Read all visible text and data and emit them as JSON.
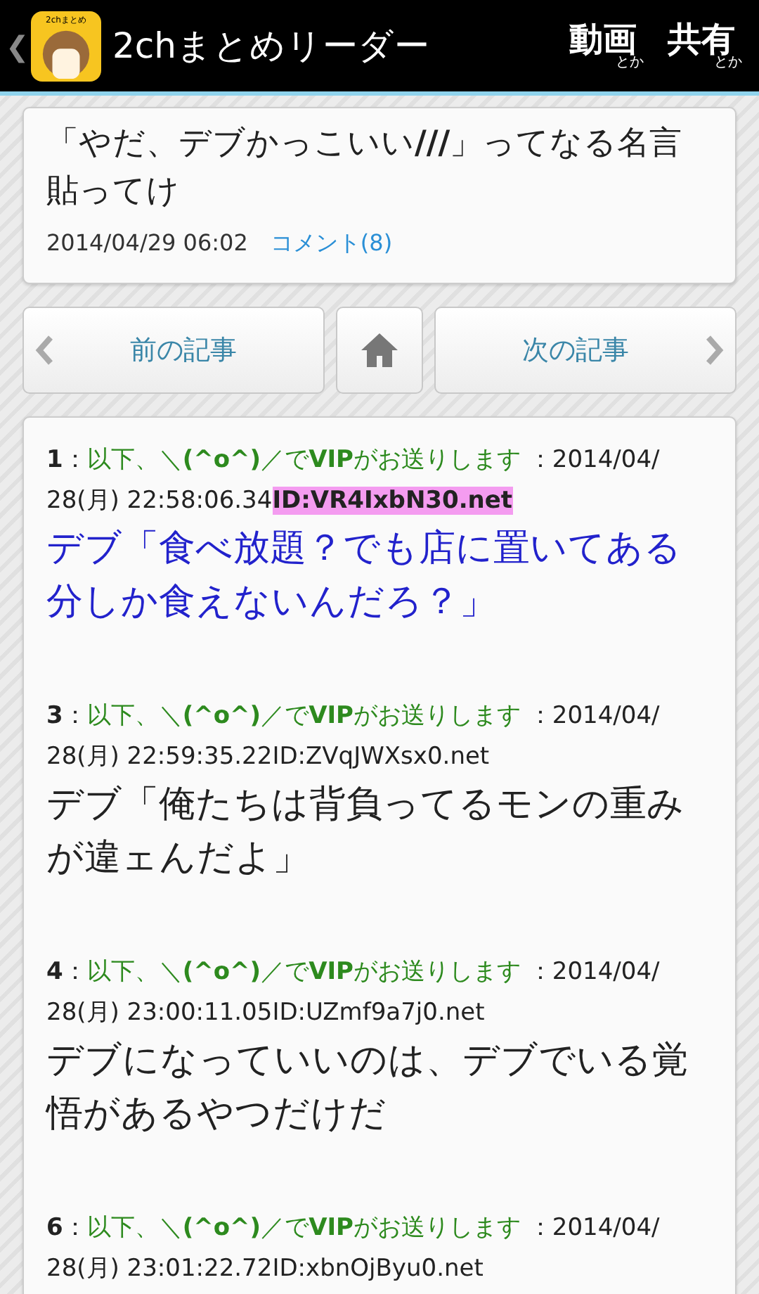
{
  "header": {
    "back": "❮",
    "app_title": "2chまとめリーダー",
    "logo_label": "2chまとめ",
    "actions": [
      {
        "label": "動画",
        "sub": "とか"
      },
      {
        "label": "共有",
        "sub": "とか"
      }
    ]
  },
  "article": {
    "title": "「やだ、デブかっこいい**///**」ってなる名言貼ってけ",
    "date": "2014/04/29 06:02",
    "comments": "コメント(8)"
  },
  "nav": {
    "prev": "前の記事",
    "next": "次の記事"
  },
  "posts": [
    {
      "number": "1",
      "sep": "：",
      "name": "以下、＼**(^o^)**／で**VIP**がお送りします",
      "date": "：2014/04/",
      "time": "28(月) 22:58:06.34",
      "id": "ID:VR4IxbN30.net",
      "id_highlighted": true,
      "body": "デブ「食べ放題？でも店に置いてある分しか食えないんだろ？」",
      "color": "#2222cc"
    },
    {
      "number": "3",
      "sep": "：",
      "name": "以下、＼**(^o^)**／で**VIP**がお送りします",
      "date": "：2014/04/",
      "time": "28(月) 22:59:35.22",
      "id": "ID:ZVqJWXsx0.net",
      "id_highlighted": false,
      "body": "デブ「俺たちは背負ってるモンの重みが違ェんだよ」",
      "color": "#222222"
    },
    {
      "number": "4",
      "sep": "：",
      "name": "以下、＼**(^o^)**／で**VIP**がお送りします",
      "date": "：2014/04/",
      "time": "28(月) 23:00:11.05",
      "id": "ID:UZmf9a7j0.net",
      "id_highlighted": false,
      "body": "デブになっていいのは、デブでいる覚悟があるやつだけだ",
      "color": "#222222"
    },
    {
      "number": "6",
      "sep": "：",
      "name": "以下、＼**(^o^)**／で**VIP**がお送りします",
      "date": "：2014/04/",
      "time": "28(月) 23:01:22.72",
      "id": "ID:xbnOjByu0.net",
      "id_highlighted": false
    }
  ]
}
